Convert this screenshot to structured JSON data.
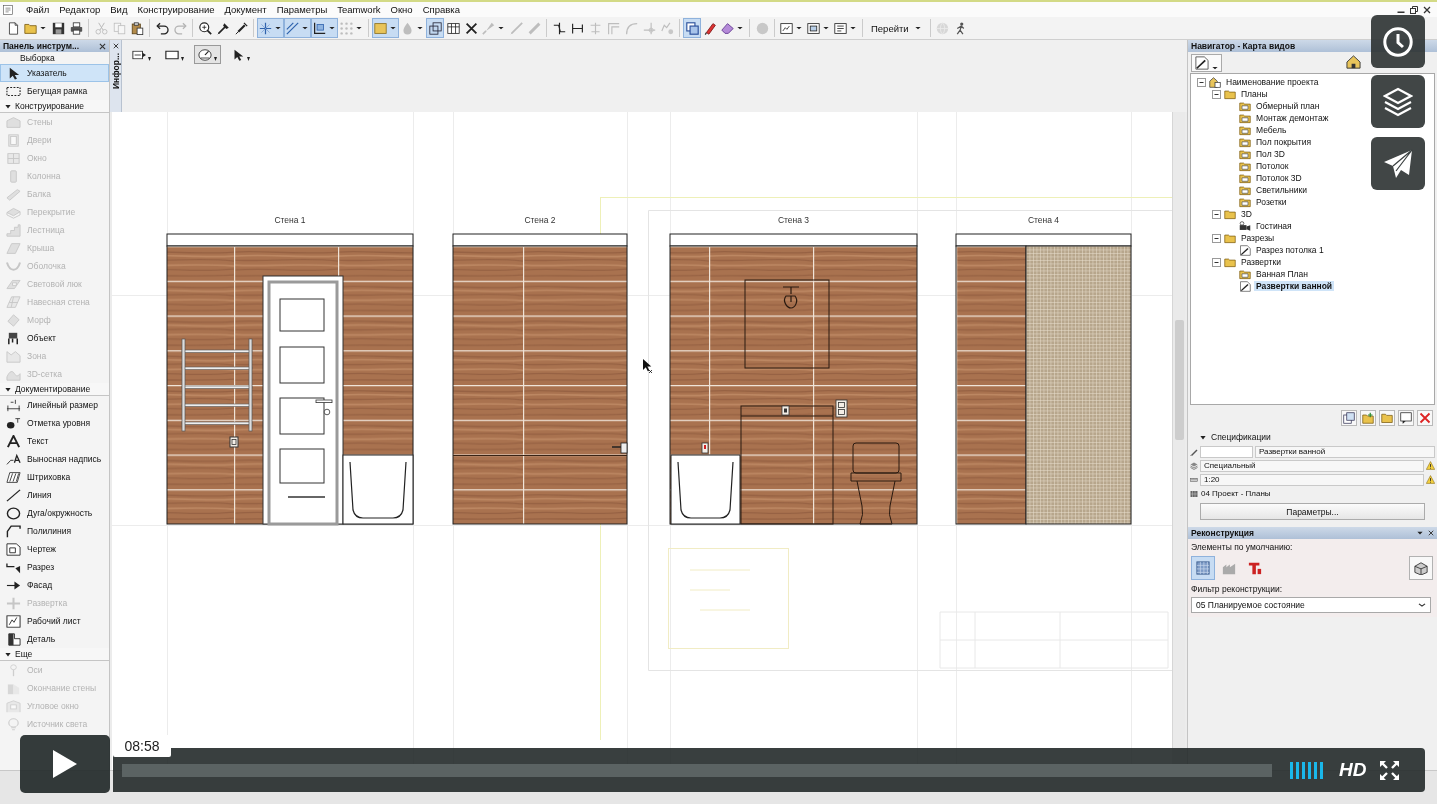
{
  "menu": [
    "Файл",
    "Редактор",
    "Вид",
    "Конструирование",
    "Документ",
    "Параметры",
    "Teamwork",
    "Окно",
    "Справка"
  ],
  "toolbar": [
    {
      "buttons": [
        {
          "kind": "new",
          "pressed": false,
          "disabled": false,
          "dropdown": false
        },
        {
          "kind": "open",
          "pressed": false,
          "disabled": false,
          "dropdown": true
        },
        {
          "kind": "save",
          "pressed": false,
          "disabled": false,
          "dropdown": false
        },
        {
          "kind": "print",
          "pressed": false,
          "disabled": false,
          "dropdown": false
        }
      ]
    },
    {
      "buttons": [
        {
          "kind": "cut",
          "pressed": false,
          "disabled": true,
          "dropdown": false
        },
        {
          "kind": "copy",
          "pressed": false,
          "disabled": true,
          "dropdown": false
        },
        {
          "kind": "paste",
          "pressed": false,
          "disabled": false,
          "dropdown": false
        }
      ]
    },
    {
      "buttons": [
        {
          "kind": "undo",
          "pressed": false,
          "disabled": false,
          "dropdown": false
        },
        {
          "kind": "redo",
          "pressed": false,
          "disabled": true,
          "dropdown": false
        }
      ]
    },
    {
      "buttons": [
        {
          "kind": "find",
          "pressed": false,
          "disabled": false,
          "dropdown": false
        },
        {
          "kind": "eyedropper",
          "pressed": false,
          "disabled": false,
          "dropdown": false
        },
        {
          "kind": "syringe",
          "pressed": false,
          "disabled": false,
          "dropdown": false
        }
      ]
    },
    {
      "buttons": [
        {
          "kind": "gravity",
          "pressed": true,
          "disabled": false,
          "dropdown": true
        },
        {
          "kind": "guide",
          "pressed": true,
          "disabled": false,
          "dropdown": true
        },
        {
          "kind": "snap",
          "pressed": true,
          "disabled": false,
          "dropdown": true
        },
        {
          "kind": "grid",
          "pressed": false,
          "disabled": true,
          "dropdown": true
        }
      ]
    },
    {
      "buttons": [
        {
          "kind": "fill",
          "pressed": true,
          "disabled": false,
          "dropdown": true
        },
        {
          "kind": "drop",
          "pressed": false,
          "disabled": true,
          "dropdown": true
        },
        {
          "kind": "trace",
          "pressed": true,
          "disabled": false,
          "dropdown": false
        },
        {
          "kind": "table",
          "pressed": false,
          "disabled": false,
          "dropdown": false
        },
        {
          "kind": "cross",
          "pressed": false,
          "disabled": false,
          "dropdown": false
        },
        {
          "kind": "brush",
          "pressed": false,
          "disabled": true,
          "dropdown": true
        },
        {
          "kind": "pen",
          "pressed": false,
          "disabled": true,
          "dropdown": false
        },
        {
          "kind": "marker",
          "pressed": false,
          "disabled": true,
          "dropdown": false
        }
      ]
    },
    {
      "buttons": [
        {
          "kind": "trim",
          "pressed": false,
          "disabled": false,
          "dropdown": false
        },
        {
          "kind": "split",
          "pressed": false,
          "disabled": false,
          "dropdown": false
        },
        {
          "kind": "adjust",
          "pressed": false,
          "disabled": true,
          "dropdown": false
        },
        {
          "kind": "offset",
          "pressed": false,
          "disabled": true,
          "dropdown": false
        },
        {
          "kind": "curve",
          "pressed": false,
          "disabled": true,
          "dropdown": false
        },
        {
          "kind": "intersect",
          "pressed": false,
          "disabled": true,
          "dropdown": false
        },
        {
          "kind": "explode",
          "pressed": false,
          "disabled": true,
          "dropdown": false
        }
      ]
    },
    {
      "buttons": [
        {
          "kind": "frame",
          "pressed": true,
          "disabled": false,
          "dropdown": false
        },
        {
          "kind": "markup",
          "pressed": false,
          "disabled": false,
          "dropdown": false
        },
        {
          "kind": "eraser",
          "pressed": false,
          "disabled": false,
          "dropdown": true
        }
      ]
    },
    {
      "buttons": [
        {
          "kind": "circle",
          "pressed": false,
          "disabled": true,
          "dropdown": false
        }
      ]
    },
    {
      "buttons": [
        {
          "kind": "view",
          "pressed": false,
          "disabled": false,
          "dropdown": true
        },
        {
          "kind": "window",
          "pressed": false,
          "disabled": false,
          "dropdown": true
        },
        {
          "kind": "layout",
          "pressed": false,
          "disabled": false,
          "dropdown": true
        }
      ]
    },
    {
      "buttons": [
        {
          "kind": "goto",
          "label": "Перейти",
          "pressed": false,
          "disabled": false,
          "dropdown": true
        }
      ]
    },
    {
      "buttons": [
        {
          "kind": "globe",
          "pressed": false,
          "disabled": true,
          "dropdown": false
        },
        {
          "kind": "walker",
          "pressed": false,
          "disabled": false,
          "dropdown": false
        }
      ]
    }
  ],
  "toolbox": {
    "title": "Панель инструм...",
    "selection": {
      "label": "Выборка",
      "tools": [
        {
          "label": "Указатель",
          "kind": "pointer",
          "selected": true,
          "disabled": false
        },
        {
          "label": "Бегущая рамка",
          "kind": "marquee",
          "selected": false,
          "disabled": false
        }
      ]
    },
    "sections": [
      {
        "label": "Конструирование",
        "expanded": true,
        "tools": [
          {
            "label": "Стены",
            "kind": "wall",
            "selected": false,
            "disabled": true
          },
          {
            "label": "Двери",
            "kind": "door",
            "selected": false,
            "disabled": true
          },
          {
            "label": "Окно",
            "kind": "window",
            "selected": false,
            "disabled": true
          },
          {
            "label": "Колонна",
            "kind": "column",
            "selected": false,
            "disabled": true
          },
          {
            "label": "Балка",
            "kind": "beam",
            "selected": false,
            "disabled": true
          },
          {
            "label": "Перекрытие",
            "kind": "slab",
            "selected": false,
            "disabled": true
          },
          {
            "label": "Лестница",
            "kind": "stair",
            "selected": false,
            "disabled": true
          },
          {
            "label": "Крыша",
            "kind": "roof",
            "selected": false,
            "disabled": true
          },
          {
            "label": "Оболочка",
            "kind": "shell",
            "selected": false,
            "disabled": true
          },
          {
            "label": "Световой люк",
            "kind": "skylight",
            "selected": false,
            "disabled": true
          },
          {
            "label": "Навесная стена",
            "kind": "curtain",
            "selected": false,
            "disabled": true
          },
          {
            "label": "Морф",
            "kind": "morph",
            "selected": false,
            "disabled": true
          },
          {
            "label": "Объект",
            "kind": "object",
            "selected": false,
            "disabled": false
          },
          {
            "label": "Зона",
            "kind": "zone",
            "selected": false,
            "disabled": true
          },
          {
            "label": "3D-сетка",
            "kind": "mesh",
            "selected": false,
            "disabled": true
          }
        ]
      },
      {
        "label": "Документирование",
        "expanded": true,
        "tools": [
          {
            "label": "Линейный размер",
            "kind": "dimension",
            "selected": false,
            "disabled": false
          },
          {
            "label": "Отметка уровня",
            "kind": "level",
            "selected": false,
            "disabled": false
          },
          {
            "label": "Текст",
            "kind": "text",
            "selected": false,
            "disabled": false
          },
          {
            "label": "Выносная надпись",
            "kind": "label",
            "selected": false,
            "disabled": false
          },
          {
            "label": "Штриховка",
            "kind": "hatch",
            "selected": false,
            "disabled": false
          },
          {
            "label": "Линия",
            "kind": "line",
            "selected": false,
            "disabled": false
          },
          {
            "label": "Дуга/окружность",
            "kind": "arc",
            "selected": false,
            "disabled": false
          },
          {
            "label": "Полилиния",
            "kind": "polyline",
            "selected": false,
            "disabled": false
          },
          {
            "label": "Чертеж",
            "kind": "drawing",
            "selected": false,
            "disabled": false
          },
          {
            "label": "Разрез",
            "kind": "section",
            "selected": false,
            "disabled": false
          },
          {
            "label": "Фасад",
            "kind": "elevation",
            "selected": false,
            "disabled": false
          },
          {
            "label": "Развертка",
            "kind": "interior",
            "selected": false,
            "disabled": true
          },
          {
            "label": "Рабочий лист",
            "kind": "worksheet",
            "selected": false,
            "disabled": false
          },
          {
            "label": "Деталь",
            "kind": "detail",
            "selected": false,
            "disabled": false
          }
        ]
      },
      {
        "label": "Еще",
        "expanded": true,
        "tools": [
          {
            "label": "Оси",
            "kind": "axis",
            "selected": false,
            "disabled": true
          },
          {
            "label": "Окончание стены",
            "kind": "wallend",
            "selected": false,
            "disabled": true
          },
          {
            "label": "Угловое окно",
            "kind": "cornerwindow",
            "selected": false,
            "disabled": true
          },
          {
            "label": "Источник света",
            "kind": "lamp",
            "selected": false,
            "disabled": true
          }
        ]
      }
    ]
  },
  "info_box": {
    "tab_label": "Инфор...",
    "options": [
      {
        "kind": "marker",
        "selected": false
      },
      {
        "kind": "rectangle",
        "selected": false
      },
      {
        "kind": "rotated",
        "selected": true
      },
      {
        "kind": "pointer",
        "selected": false
      }
    ]
  },
  "canvas": {
    "elevations": [
      {
        "title": "Стена 1",
        "kind": "entrance"
      },
      {
        "title": "Стена 2",
        "kind": "plain"
      },
      {
        "title": "Стена 3",
        "kind": "vanity"
      },
      {
        "title": "Стена 4",
        "kind": "mosaic"
      }
    ]
  },
  "navigator": {
    "title": "Навигатор - Карта видов",
    "tree": [
      {
        "label": "Наименование проекта",
        "kind": "project",
        "expanded": true,
        "selected": false,
        "children": [
          {
            "label": "Планы",
            "kind": "folder",
            "expanded": true,
            "selected": false,
            "children": [
              {
                "label": "Обмерный план",
                "kind": "plan",
                "selected": false
              },
              {
                "label": "Монтаж демонтаж",
                "kind": "plan",
                "selected": false
              },
              {
                "label": "Мебель",
                "kind": "plan",
                "selected": false
              },
              {
                "label": "Пол покрытия",
                "kind": "plan",
                "selected": false
              },
              {
                "label": "Пол 3D",
                "kind": "plan",
                "selected": false
              },
              {
                "label": "Потолок",
                "kind": "plan",
                "selected": false
              },
              {
                "label": "Потолок 3D",
                "kind": "plan",
                "selected": false
              },
              {
                "label": "Светильники",
                "kind": "plan",
                "selected": false
              },
              {
                "label": "Розетки",
                "kind": "plan",
                "selected": false
              }
            ]
          },
          {
            "label": "3D",
            "kind": "folder",
            "expanded": true,
            "selected": false,
            "children": [
              {
                "label": "Гостиная",
                "kind": "camera",
                "selected": false
              }
            ]
          },
          {
            "label": "Разрезы",
            "kind": "folder",
            "expanded": true,
            "selected": false,
            "children": [
              {
                "label": "Разрез потолка 1",
                "kind": "section",
                "selected": false
              }
            ]
          },
          {
            "label": "Развертки",
            "kind": "folder",
            "expanded": true,
            "selected": false,
            "children": [
              {
                "label": "Ванная План",
                "kind": "plan",
                "selected": false
              },
              {
                "label": "Развертки ванной",
                "kind": "elevation",
                "selected": true
              }
            ]
          }
        ]
      }
    ]
  },
  "view_settings": {
    "label": "Спецификации",
    "expanded": true,
    "name": "Развертки ванной",
    "rows": [
      {
        "kind": "layer",
        "value": "Специальный",
        "warning": true
      },
      {
        "kind": "scale",
        "value": "1:20",
        "warning": true
      },
      {
        "kind": "penset",
        "value": "04 Проект - Планы",
        "warning": false
      }
    ],
    "button": "Параметры..."
  },
  "renovation": {
    "title": "Реконструкция",
    "defaults_label": "Элементы по умолчанию:",
    "statuses": [
      {
        "kind": "existing",
        "selected": true
      },
      {
        "kind": "demolished",
        "selected": false
      },
      {
        "kind": "new",
        "selected": false
      }
    ],
    "filter_label": "Фильтр реконструкции:",
    "filter_value": "05 Планируемое состояние"
  },
  "video_player": {
    "time": "08:58",
    "quality": "HD"
  }
}
